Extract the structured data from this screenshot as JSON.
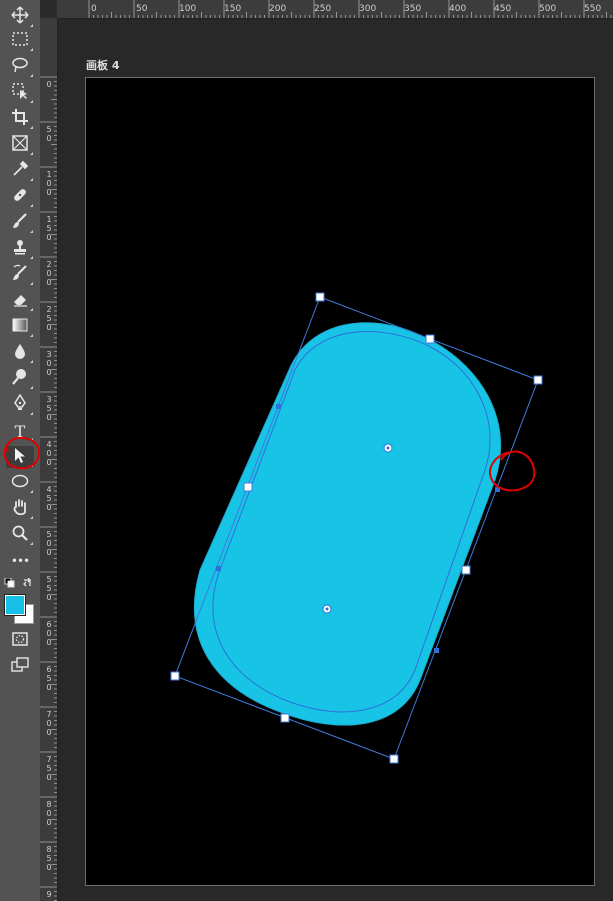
{
  "app": {
    "name": "Photoshop"
  },
  "artboard": {
    "label": "画板 4"
  },
  "ruler": {
    "horizontal": [
      "0",
      "50",
      "100",
      "150",
      "200",
      "250",
      "300",
      "350",
      "400",
      "450",
      "500",
      "550"
    ],
    "vertical": [
      "0",
      "50",
      "100",
      "150",
      "200",
      "250",
      "300",
      "350",
      "400",
      "450",
      "500",
      "550",
      "600",
      "650",
      "700",
      "750",
      "800",
      "850",
      "9"
    ]
  },
  "toolbar": {
    "tools": [
      {
        "name": "move-tool",
        "icon": "move-icon"
      },
      {
        "name": "marquee-tool",
        "icon": "rect-marquee-icon"
      },
      {
        "name": "lasso-tool",
        "icon": "lasso-icon"
      },
      {
        "name": "object-select-tool",
        "icon": "object-select-icon"
      },
      {
        "name": "crop-tool",
        "icon": "crop-icon"
      },
      {
        "name": "frame-tool",
        "icon": "frame-icon"
      },
      {
        "name": "eyedropper-tool",
        "icon": "eyedropper-icon"
      },
      {
        "name": "healing-brush-tool",
        "icon": "bandage-icon"
      },
      {
        "name": "brush-tool",
        "icon": "brush-icon"
      },
      {
        "name": "clone-stamp-tool",
        "icon": "stamp-icon"
      },
      {
        "name": "history-brush-tool",
        "icon": "history-brush-icon"
      },
      {
        "name": "eraser-tool",
        "icon": "eraser-icon"
      },
      {
        "name": "gradient-tool",
        "icon": "gradient-icon"
      },
      {
        "name": "blur-tool",
        "icon": "drop-icon"
      },
      {
        "name": "dodge-tool",
        "icon": "dodge-icon"
      },
      {
        "name": "pen-tool",
        "icon": "pen-icon"
      },
      {
        "name": "type-tool",
        "icon": "type-icon",
        "glyph": "T"
      },
      {
        "name": "direct-selection-tool",
        "icon": "direct-select-arrow-icon",
        "active": true
      },
      {
        "name": "ellipse-tool",
        "icon": "ellipse-icon"
      },
      {
        "name": "hand-tool",
        "icon": "hand-icon"
      },
      {
        "name": "zoom-tool",
        "icon": "zoom-icon"
      },
      {
        "name": "edit-toolbar",
        "icon": "more-icon",
        "glyph": "•••"
      }
    ],
    "foreground_color": "#17c0e6",
    "background_color": "#ffffff"
  },
  "shape": {
    "fill": "#17c4e6",
    "path_color": "#2f6fd9",
    "annotation_color": "#e00000"
  }
}
